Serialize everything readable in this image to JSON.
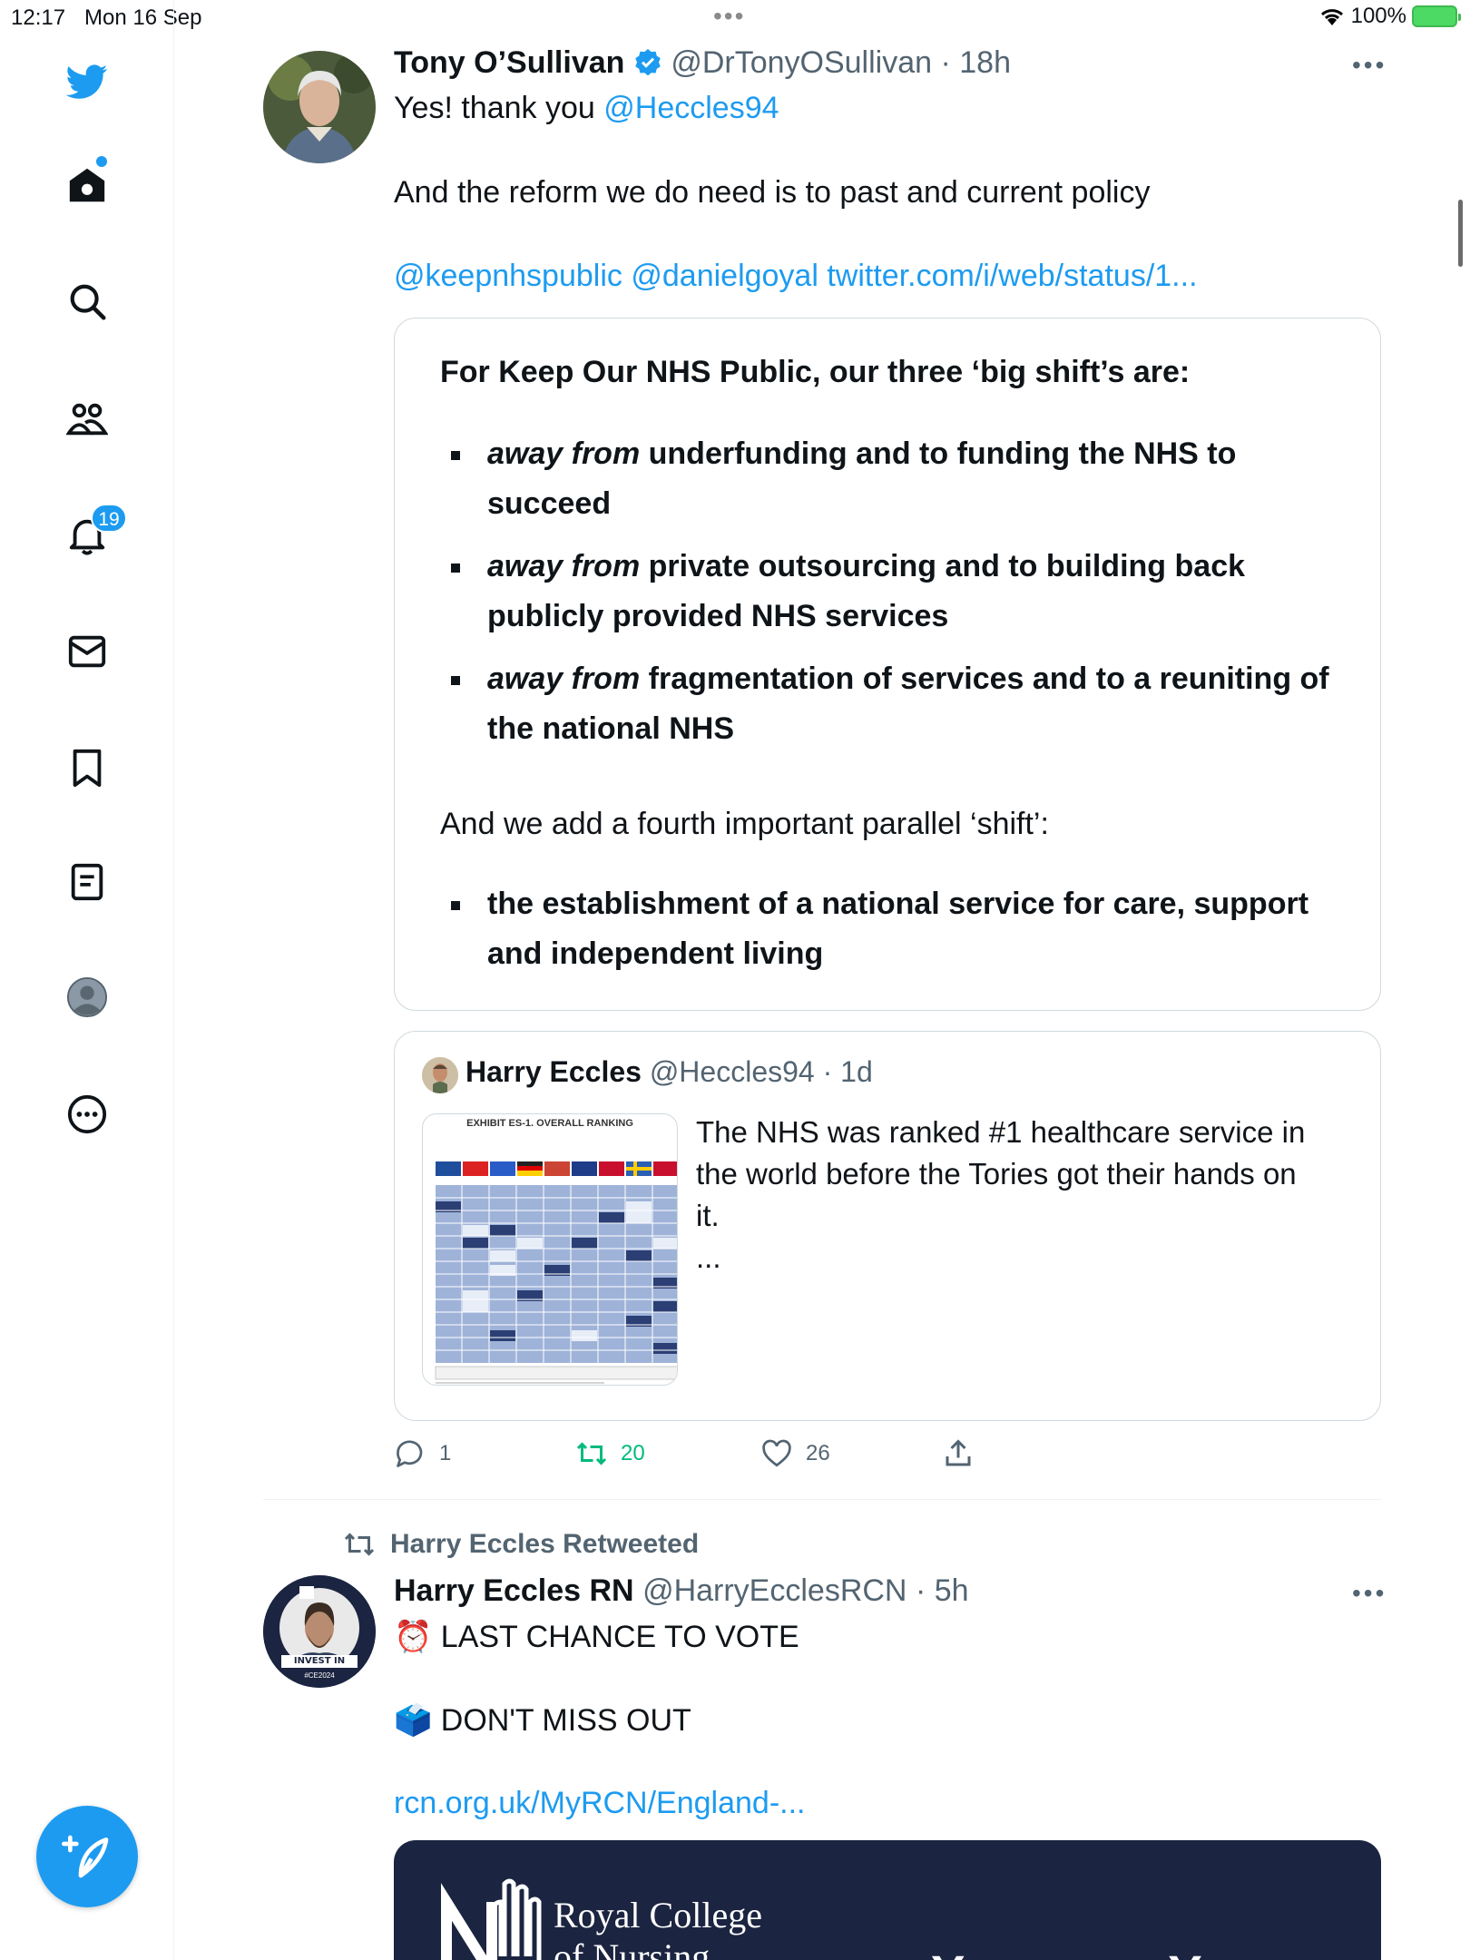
{
  "status_bar": {
    "time": "12:17",
    "date": "Mon 16 Sep",
    "battery": "100%"
  },
  "sidebar": {
    "notifications_badge": "19",
    "items": [
      "twitter-logo",
      "home-icon",
      "search-icon",
      "communities-icon",
      "notifications-icon",
      "messages-icon",
      "bookmarks-icon",
      "lists-icon",
      "profile-icon",
      "more-icon"
    ]
  },
  "tweet1": {
    "name": "Tony O’Sullivan",
    "handle": "@DrTonyOSullivan",
    "time": "· 18h",
    "line1_text": "Yes! thank you ",
    "line1_link": "@Heccles94",
    "line2": "And the reform we do need is to past and current policy",
    "links": [
      "@keepnhspublic",
      "@danielgoyal",
      "twitter.com/i/web/status/1..."
    ],
    "image_card": {
      "title": "For Keep Our NHS Public, our three ‘big shift’s are:",
      "bullets": [
        {
          "em": "away from",
          "line1": " underfunding and to funding the NHS to",
          "line2": "succeed"
        },
        {
          "em": "away from",
          "line1": " private outsourcing and to building back",
          "line2": "publicly provided NHS services"
        },
        {
          "em": "away from",
          "line1": " fragmentation of services and to a reuniting of",
          "line2": "the national NHS"
        }
      ],
      "fourth_intro": "And we add a fourth important parallel ‘shift’:",
      "fourth_bullet": {
        "line1": "the establishment of a national service for care, support",
        "line2": "and independent living"
      }
    },
    "quoted": {
      "name": "Harry Eccles",
      "handle": "@Heccles94",
      "time": "· 1d",
      "thumb_title": "EXHIBIT ES-1. OVERALL RANKING",
      "text_lines": [
        "The NHS was ranked #1 healthcare service in",
        "the world before the Tories got their hands on",
        "it.",
        "..."
      ]
    },
    "actions": {
      "replies": "1",
      "retweets": "20",
      "likes": "26"
    },
    "colors": {
      "retweet": "#00ba7c",
      "link": "#1d9bf0"
    }
  },
  "tweet2": {
    "retweeted_by": "Harry Eccles Retweeted",
    "name": "Harry Eccles RN",
    "handle": "@HarryEcclesRCN",
    "time": "· 5h",
    "line1": "⏰ LAST CHANCE TO VOTE",
    "line2": "🗳️ DON'T MISS OUT",
    "link": "rcn.org.uk/MyRCN/England-...",
    "avatar_labels": [
      "INVEST IN NURSING",
      "#CE2024"
    ],
    "card": {
      "org_line1": "Royal College",
      "org_line2": "of Nursing",
      "headline": "Your pay. Your say."
    }
  }
}
